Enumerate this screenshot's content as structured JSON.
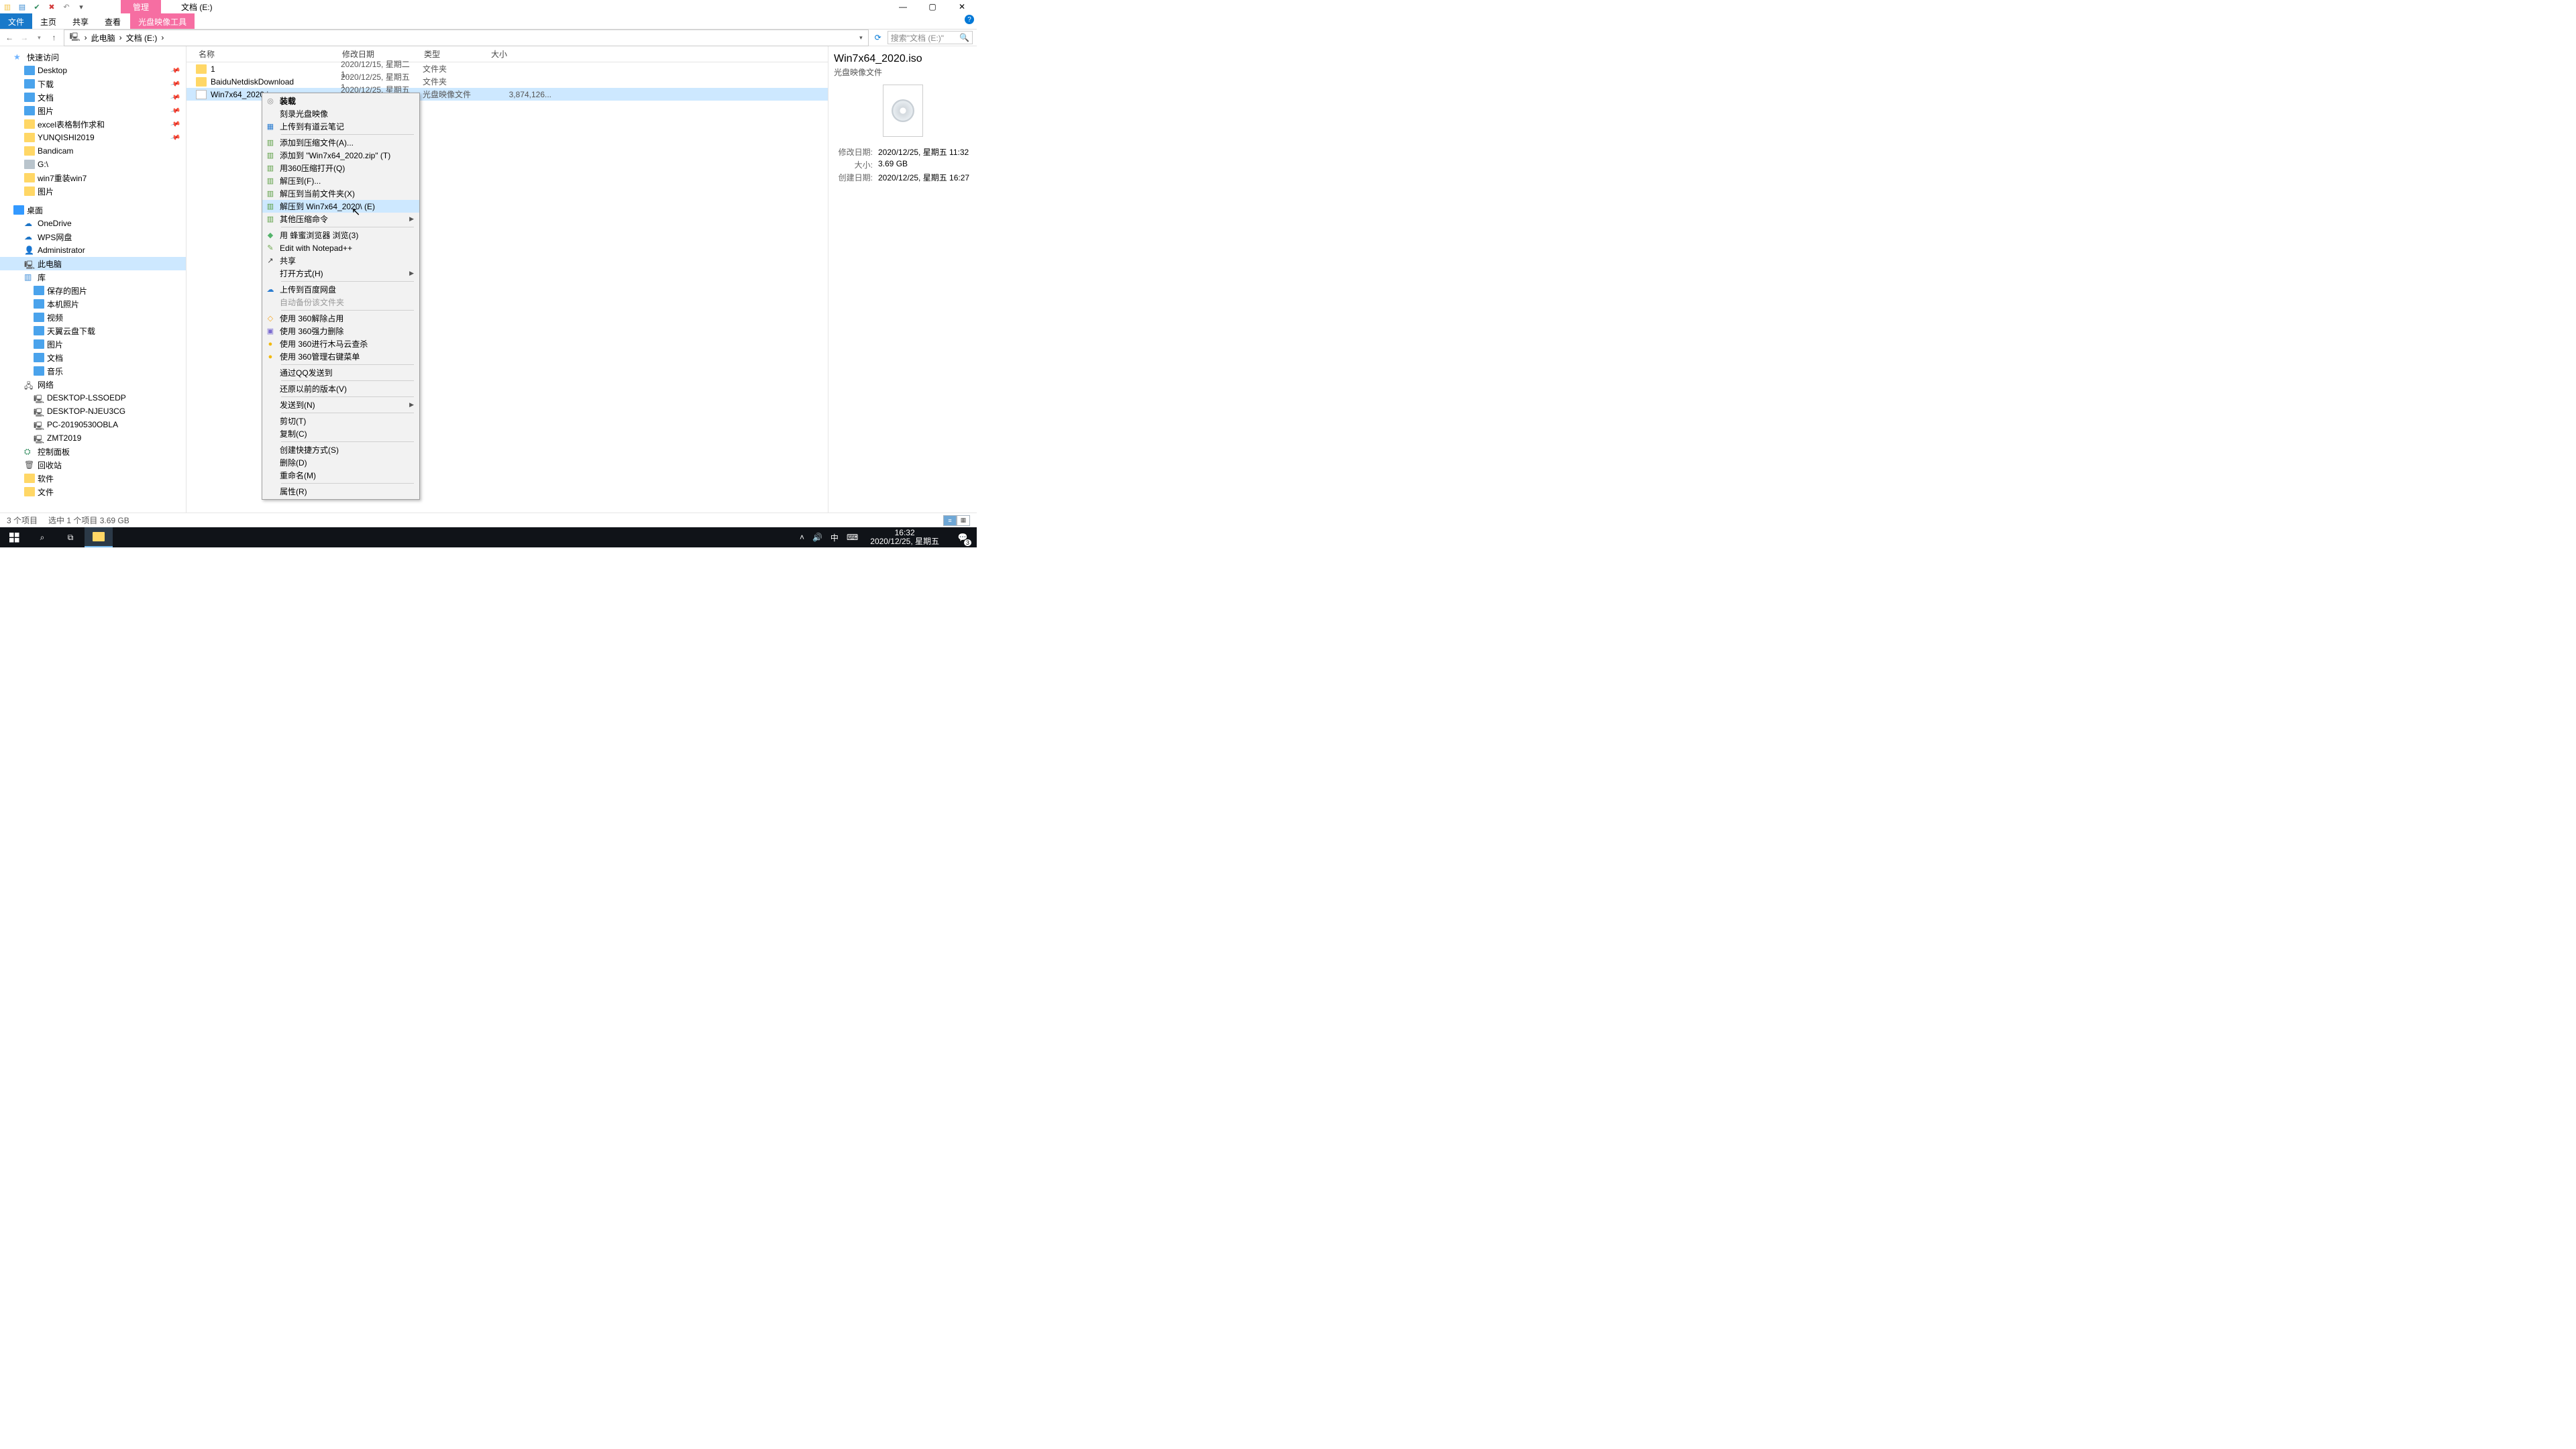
{
  "title": "文档 (E:)",
  "contextual_tab": "管理",
  "under_tab": "光盘映像工具",
  "ribbon": {
    "file": "文件",
    "home": "主页",
    "share": "共享",
    "view": "查看"
  },
  "crumbs": [
    "此电脑",
    "文档 (E:)"
  ],
  "search_placeholder": "搜索\"文档 (E:)\"",
  "columns": {
    "name": "名称",
    "modified": "修改日期",
    "type": "类型",
    "size": "大小"
  },
  "nav": {
    "quick": "快速访问",
    "quick_items": [
      "Desktop",
      "下载",
      "文档",
      "图片",
      "excel表格制作求和",
      "YUNQISHI2019",
      "Bandicam",
      "G:\\",
      "win7重装win7",
      "图片"
    ],
    "desktop": "桌面",
    "desktop_items": [
      "OneDrive",
      "WPS网盘",
      "Administrator",
      "此电脑",
      "库"
    ],
    "lib_items": [
      "保存的图片",
      "本机照片",
      "视频",
      "天翼云盘下载",
      "图片",
      "文档",
      "音乐"
    ],
    "network": "网络",
    "net_items": [
      "DESKTOP-LSSOEDP",
      "DESKTOP-NJEU3CG",
      "PC-20190530OBLA",
      "ZMT2019"
    ],
    "tail": [
      "控制面板",
      "回收站",
      "软件",
      "文件"
    ]
  },
  "rows": [
    {
      "name": "1",
      "date": "2020/12/15, 星期二 1...",
      "type": "文件夹",
      "size": ""
    },
    {
      "name": "BaiduNetdiskDownload",
      "date": "2020/12/25, 星期五 1...",
      "type": "文件夹",
      "size": ""
    },
    {
      "name": "Win7x64_2020.iso",
      "date": "2020/12/25, 星期五 1...",
      "type": "光盘映像文件",
      "size": "3,874,126..."
    }
  ],
  "preview": {
    "title": "Win7x64_2020.iso",
    "subtitle": "光盘映像文件",
    "mod_k": "修改日期:",
    "mod_v": "2020/12/25, 星期五 11:32",
    "size_k": "大小:",
    "size_v": "3.69 GB",
    "created_k": "创建日期:",
    "created_v": "2020/12/25, 星期五 16:27"
  },
  "status": {
    "items": "3 个项目",
    "selected": "选中 1 个项目  3.69 GB"
  },
  "ctx": [
    {
      "t": "装载",
      "bold": true,
      "ic": "disc"
    },
    {
      "t": "刻录光盘映像"
    },
    {
      "t": "上传到有道云笔记",
      "ic": "note"
    },
    {
      "sep": true
    },
    {
      "t": "添加到压缩文件(A)...",
      "ic": "zip"
    },
    {
      "t": "添加到 \"Win7x64_2020.zip\" (T)",
      "ic": "zip"
    },
    {
      "t": "用360压缩打开(Q)",
      "ic": "zip"
    },
    {
      "t": "解压到(F)...",
      "ic": "zip"
    },
    {
      "t": "解压到当前文件夹(X)",
      "ic": "zip"
    },
    {
      "t": "解压到 Win7x64_2020\\ (E)",
      "ic": "zip",
      "hi": true
    },
    {
      "t": "其他压缩命令",
      "ic": "zip",
      "sub": true
    },
    {
      "sep": true
    },
    {
      "t": "用 蜂蜜浏览器 浏览(3)",
      "ic": "bee"
    },
    {
      "t": "Edit with Notepad++",
      "ic": "npp"
    },
    {
      "t": "共享",
      "ic": "share"
    },
    {
      "t": "打开方式(H)",
      "sub": true
    },
    {
      "sep": true
    },
    {
      "t": "上传到百度网盘",
      "ic": "baidu"
    },
    {
      "t": "自动备份该文件夹",
      "disabled": true
    },
    {
      "sep": true
    },
    {
      "t": "使用 360解除占用",
      "ic": "360o"
    },
    {
      "t": "使用 360强力删除",
      "ic": "360d"
    },
    {
      "t": "使用 360进行木马云查杀",
      "ic": "360y"
    },
    {
      "t": "使用 360管理右键菜单",
      "ic": "360y"
    },
    {
      "sep": true
    },
    {
      "t": "通过QQ发送到"
    },
    {
      "sep": true
    },
    {
      "t": "还原以前的版本(V)"
    },
    {
      "sep": true
    },
    {
      "t": "发送到(N)",
      "sub": true
    },
    {
      "sep": true
    },
    {
      "t": "剪切(T)"
    },
    {
      "t": "复制(C)"
    },
    {
      "sep": true
    },
    {
      "t": "创建快捷方式(S)"
    },
    {
      "t": "删除(D)"
    },
    {
      "t": "重命名(M)"
    },
    {
      "sep": true
    },
    {
      "t": "属性(R)"
    }
  ],
  "taskbar": {
    "time": "16:32",
    "date": "2020/12/25, 星期五",
    "ime": "中",
    "notif": "3"
  }
}
